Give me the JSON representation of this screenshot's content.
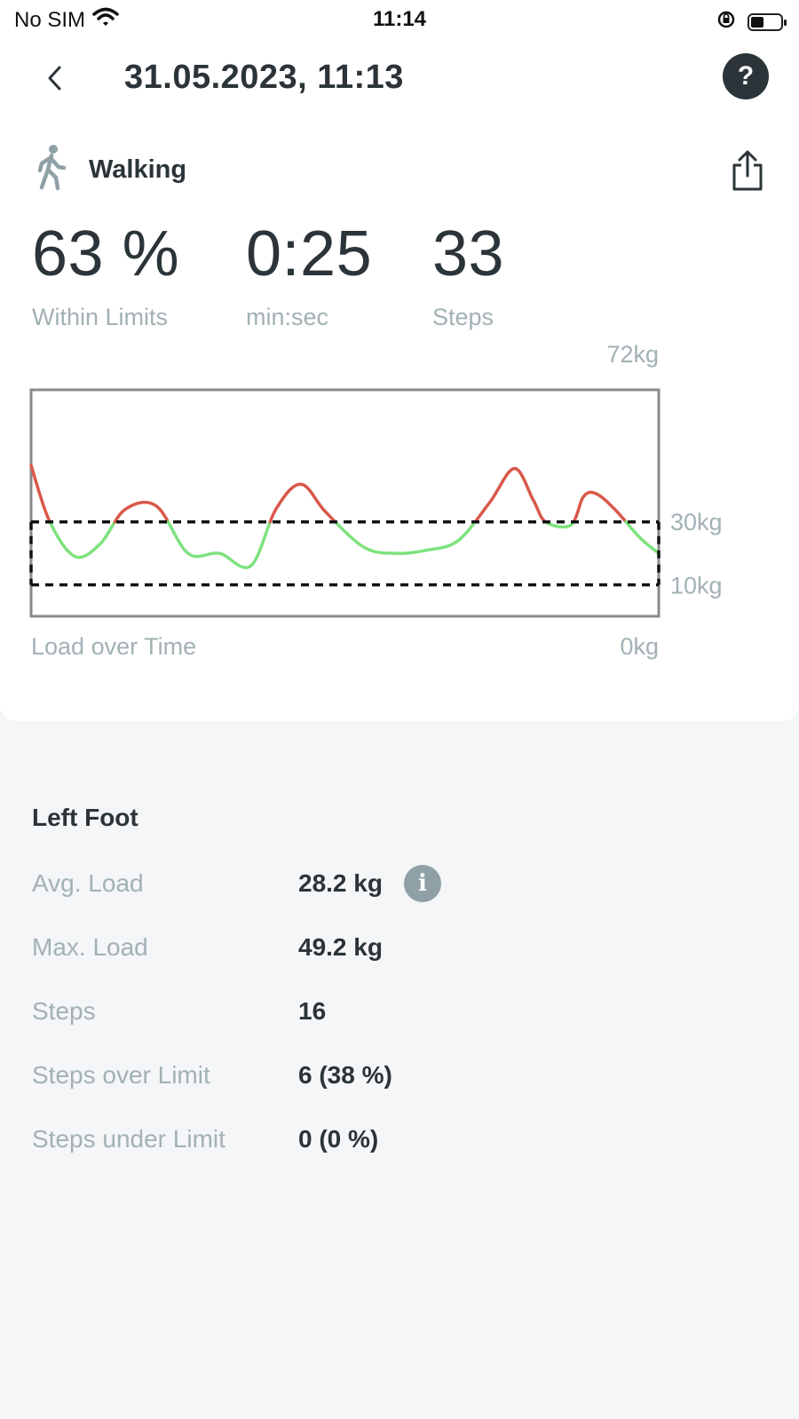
{
  "status_bar": {
    "carrier": "No SIM",
    "time": "11:14"
  },
  "nav": {
    "title": "31.05.2023, 11:13",
    "help_label": "?"
  },
  "activity": {
    "label": "Walking",
    "icon": "walking-person-icon"
  },
  "metrics": [
    {
      "value": "63 %",
      "label": "Within Limits"
    },
    {
      "value": "0:25",
      "label": "min:sec"
    },
    {
      "value": "33",
      "label": "Steps"
    }
  ],
  "chart": {
    "max_label": "72kg",
    "upper_limit_label": "30kg",
    "lower_limit_label": "10kg",
    "zero_label": "0kg",
    "caption": "Load over Time"
  },
  "chart_data": {
    "type": "line",
    "title": "",
    "xlabel": "Load over Time",
    "ylabel": "",
    "ylim": [
      0,
      72
    ],
    "limits": {
      "upper": 30,
      "lower": 10
    },
    "colors": {
      "within": "#7ee27e",
      "over": "#d9584a",
      "limit_line": "#111111",
      "frame": "#8a8a8a"
    },
    "x": [
      0,
      0.03,
      0.07,
      0.11,
      0.15,
      0.2,
      0.25,
      0.3,
      0.35,
      0.39,
      0.43,
      0.47,
      0.53,
      0.58,
      0.63,
      0.68,
      0.73,
      0.77,
      0.8,
      0.82,
      0.86,
      0.88,
      0.9,
      0.93,
      0.97,
      1.0
    ],
    "values": [
      48,
      30,
      19,
      23,
      34,
      35,
      20,
      20,
      16,
      34,
      42,
      33,
      22,
      20,
      21,
      24,
      36,
      47,
      37,
      30,
      29,
      38,
      39,
      34,
      25,
      20
    ]
  },
  "left_foot": {
    "title": "Left Foot",
    "rows": [
      {
        "label": "Avg. Load",
        "value": "28.2 kg"
      },
      {
        "label": "Max. Load",
        "value": "49.2 kg"
      },
      {
        "label": "Steps",
        "value": "16"
      },
      {
        "label": "Steps over Limit",
        "value": "6 (38 %)"
      },
      {
        "label": "Steps under Limit",
        "value": "0 (0 %)"
      }
    ],
    "info_label": "i"
  }
}
